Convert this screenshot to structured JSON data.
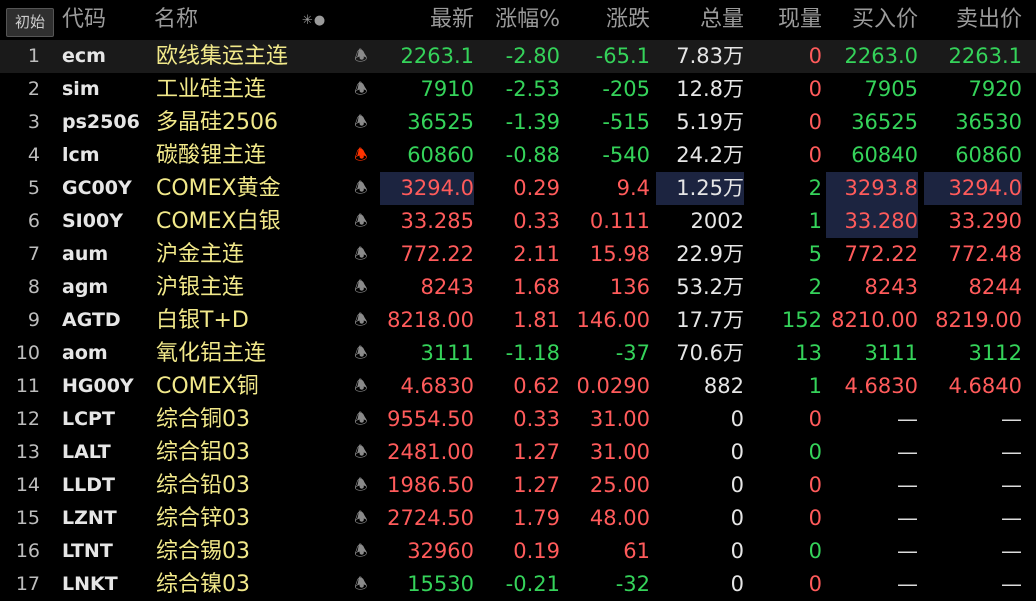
{
  "header": {
    "init_button": "初始",
    "sort_icon": "✳●",
    "columns": {
      "code": "代码",
      "name": "名称",
      "latest": "最新",
      "pct": "涨幅%",
      "change": "涨跌",
      "volume": "总量",
      "current": "现量",
      "bid": "买入价",
      "ask": "卖出价"
    }
  },
  "icons": {
    "bell": "bell-icon"
  },
  "colors": {
    "up": "#ff5b5b",
    "down": "#35d35a",
    "name": "#f2e98a",
    "alert_bell": "#ff3300"
  },
  "rows": [
    {
      "idx": "1",
      "code": "ecm",
      "name": "欧线集运主连",
      "latest": "2263.1",
      "pct": "-2.80",
      "change": "-65.1",
      "volume": "7.83万",
      "current": "0",
      "bid": "2263.0",
      "ask": "2263.1"
    },
    {
      "idx": "2",
      "code": "sim",
      "name": "工业硅主连",
      "latest": "7910",
      "pct": "-2.53",
      "change": "-205",
      "volume": "12.8万",
      "current": "0",
      "bid": "7905",
      "ask": "7920"
    },
    {
      "idx": "3",
      "code": "ps2506",
      "name": "多晶硅2506",
      "latest": "36525",
      "pct": "-1.39",
      "change": "-515",
      "volume": "5.19万",
      "current": "0",
      "bid": "36525",
      "ask": "36530"
    },
    {
      "idx": "4",
      "code": "lcm",
      "name": "碳酸锂主连",
      "latest": "60860",
      "pct": "-0.88",
      "change": "-540",
      "volume": "24.2万",
      "current": "0",
      "bid": "60840",
      "ask": "60860"
    },
    {
      "idx": "5",
      "code": "GC00Y",
      "name": "COMEX黄金",
      "latest": "3294.0",
      "pct": "0.29",
      "change": "9.4",
      "volume": "1.25万",
      "current": "2",
      "bid": "3293.8",
      "ask": "3294.0"
    },
    {
      "idx": "6",
      "code": "SI00Y",
      "name": "COMEX白银",
      "latest": "33.285",
      "pct": "0.33",
      "change": "0.111",
      "volume": "2002",
      "current": "1",
      "bid": "33.280",
      "ask": "33.290"
    },
    {
      "idx": "7",
      "code": "aum",
      "name": "沪金主连",
      "latest": "772.22",
      "pct": "2.11",
      "change": "15.98",
      "volume": "22.9万",
      "current": "5",
      "bid": "772.22",
      "ask": "772.48"
    },
    {
      "idx": "8",
      "code": "agm",
      "name": "沪银主连",
      "latest": "8243",
      "pct": "1.68",
      "change": "136",
      "volume": "53.2万",
      "current": "2",
      "bid": "8243",
      "ask": "8244"
    },
    {
      "idx": "9",
      "code": "AGTD",
      "name": "白银T+D",
      "latest": "8218.00",
      "pct": "1.81",
      "change": "146.00",
      "volume": "17.7万",
      "current": "152",
      "bid": "8210.00",
      "ask": "8219.00"
    },
    {
      "idx": "10",
      "code": "aom",
      "name": "氧化铝主连",
      "latest": "3111",
      "pct": "-1.18",
      "change": "-37",
      "volume": "70.6万",
      "current": "13",
      "bid": "3111",
      "ask": "3112"
    },
    {
      "idx": "11",
      "code": "HG00Y",
      "name": "COMEX铜",
      "latest": "4.6830",
      "pct": "0.62",
      "change": "0.0290",
      "volume": "882",
      "current": "1",
      "bid": "4.6830",
      "ask": "4.6840"
    },
    {
      "idx": "12",
      "code": "LCPT",
      "name": "综合铜03",
      "latest": "9554.50",
      "pct": "0.33",
      "change": "31.00",
      "volume": "0",
      "current": "0",
      "bid": "—",
      "ask": "—"
    },
    {
      "idx": "13",
      "code": "LALT",
      "name": "综合铝03",
      "latest": "2481.00",
      "pct": "1.27",
      "change": "31.00",
      "volume": "0",
      "current": "0",
      "bid": "—",
      "ask": "—"
    },
    {
      "idx": "14",
      "code": "LLDT",
      "name": "综合铅03",
      "latest": "1986.50",
      "pct": "1.27",
      "change": "25.00",
      "volume": "0",
      "current": "0",
      "bid": "—",
      "ask": "—"
    },
    {
      "idx": "15",
      "code": "LZNT",
      "name": "综合锌03",
      "latest": "2724.50",
      "pct": "1.79",
      "change": "48.00",
      "volume": "0",
      "current": "0",
      "bid": "—",
      "ask": "—"
    },
    {
      "idx": "16",
      "code": "LTNT",
      "name": "综合锡03",
      "latest": "32960",
      "pct": "0.19",
      "change": "61",
      "volume": "0",
      "current": "0",
      "bid": "—",
      "ask": "—"
    },
    {
      "idx": "17",
      "code": "LNKT",
      "name": "综合镍03",
      "latest": "15530",
      "pct": "-0.21",
      "change": "-32",
      "volume": "0",
      "current": "0",
      "bid": "—",
      "ask": "—"
    }
  ]
}
